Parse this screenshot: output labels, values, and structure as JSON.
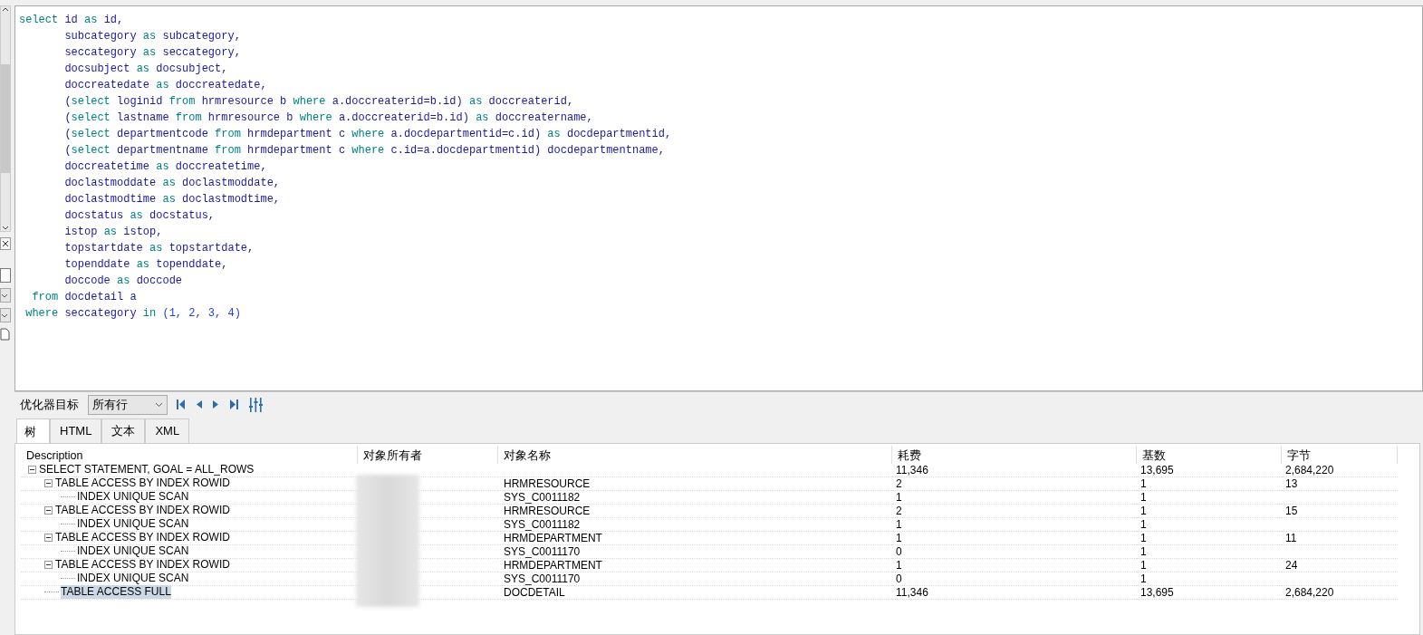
{
  "editor": {
    "lines": [
      [
        {
          "kind": "kw",
          "text": "select"
        },
        {
          "kind": "id",
          "text": " id "
        },
        {
          "kind": "kw",
          "text": "as"
        },
        {
          "kind": "id",
          "text": " id,"
        }
      ],
      [
        {
          "kind": "id",
          "text": "       subcategory "
        },
        {
          "kind": "kw",
          "text": "as"
        },
        {
          "kind": "id",
          "text": " subcategory,"
        }
      ],
      [
        {
          "kind": "id",
          "text": "       seccategory "
        },
        {
          "kind": "kw",
          "text": "as"
        },
        {
          "kind": "id",
          "text": " seccategory,"
        }
      ],
      [
        {
          "kind": "id",
          "text": "       docsubject "
        },
        {
          "kind": "kw",
          "text": "as"
        },
        {
          "kind": "id",
          "text": " docsubject,"
        }
      ],
      [
        {
          "kind": "id",
          "text": "       doccreatedate "
        },
        {
          "kind": "kw",
          "text": "as"
        },
        {
          "kind": "id",
          "text": " doccreatedate,"
        }
      ],
      [
        {
          "kind": "id",
          "text": "       ("
        },
        {
          "kind": "kw",
          "text": "select"
        },
        {
          "kind": "id",
          "text": " loginid "
        },
        {
          "kind": "kw",
          "text": "from"
        },
        {
          "kind": "id",
          "text": " hrmresource b "
        },
        {
          "kind": "kw",
          "text": "where"
        },
        {
          "kind": "id",
          "text": " a.doccreaterid=b.id) "
        },
        {
          "kind": "kw",
          "text": "as"
        },
        {
          "kind": "id",
          "text": " doccreaterid,"
        }
      ],
      [
        {
          "kind": "id",
          "text": "       ("
        },
        {
          "kind": "kw",
          "text": "select"
        },
        {
          "kind": "id",
          "text": " lastname "
        },
        {
          "kind": "kw",
          "text": "from"
        },
        {
          "kind": "id",
          "text": " hrmresource b "
        },
        {
          "kind": "kw",
          "text": "where"
        },
        {
          "kind": "id",
          "text": " a.doccreaterid=b.id) "
        },
        {
          "kind": "kw",
          "text": "as"
        },
        {
          "kind": "id",
          "text": " doccreatername,"
        }
      ],
      [
        {
          "kind": "id",
          "text": "       ("
        },
        {
          "kind": "kw",
          "text": "select"
        },
        {
          "kind": "id",
          "text": " departmentcode "
        },
        {
          "kind": "kw",
          "text": "from"
        },
        {
          "kind": "id",
          "text": " hrmdepartment c "
        },
        {
          "kind": "kw",
          "text": "where"
        },
        {
          "kind": "id",
          "text": " a.docdepartmentid=c.id) "
        },
        {
          "kind": "kw",
          "text": "as"
        },
        {
          "kind": "id",
          "text": " docdepartmentid,"
        }
      ],
      [
        {
          "kind": "id",
          "text": "       ("
        },
        {
          "kind": "kw",
          "text": "select"
        },
        {
          "kind": "id",
          "text": " departmentname "
        },
        {
          "kind": "kw",
          "text": "from"
        },
        {
          "kind": "id",
          "text": " hrmdepartment c "
        },
        {
          "kind": "kw",
          "text": "where"
        },
        {
          "kind": "id",
          "text": " c.id=a.docdepartmentid) docdepartmentname,"
        }
      ],
      [
        {
          "kind": "id",
          "text": "       doccreatetime "
        },
        {
          "kind": "kw",
          "text": "as"
        },
        {
          "kind": "id",
          "text": " doccreatetime,"
        }
      ],
      [
        {
          "kind": "id",
          "text": "       doclastmoddate "
        },
        {
          "kind": "kw",
          "text": "as"
        },
        {
          "kind": "id",
          "text": " doclastmoddate,"
        }
      ],
      [
        {
          "kind": "id",
          "text": "       doclastmodtime "
        },
        {
          "kind": "kw",
          "text": "as"
        },
        {
          "kind": "id",
          "text": " doclastmodtime,"
        }
      ],
      [
        {
          "kind": "id",
          "text": "       docstatus "
        },
        {
          "kind": "kw",
          "text": "as"
        },
        {
          "kind": "id",
          "text": " docstatus,"
        }
      ],
      [
        {
          "kind": "id",
          "text": "       istop "
        },
        {
          "kind": "kw",
          "text": "as"
        },
        {
          "kind": "id",
          "text": " istop,"
        }
      ],
      [
        {
          "kind": "id",
          "text": "       topstartdate "
        },
        {
          "kind": "kw",
          "text": "as"
        },
        {
          "kind": "id",
          "text": " topstartdate,"
        }
      ],
      [
        {
          "kind": "id",
          "text": "       topenddate "
        },
        {
          "kind": "kw",
          "text": "as"
        },
        {
          "kind": "id",
          "text": " topenddate,"
        }
      ],
      [
        {
          "kind": "id",
          "text": "       doccode "
        },
        {
          "kind": "kw",
          "text": "as"
        },
        {
          "kind": "id",
          "text": " doccode"
        }
      ],
      [
        {
          "kind": "kw",
          "text": "  from"
        },
        {
          "kind": "id",
          "text": " docdetail a"
        }
      ],
      [
        {
          "kind": "kw",
          "text": " where"
        },
        {
          "kind": "id",
          "text": " seccategory "
        },
        {
          "kind": "kw",
          "text": "in"
        },
        {
          "kind": "num",
          "text": " (1, 2, 3, 4)"
        }
      ]
    ]
  },
  "toolbar": {
    "label": "优化器目标",
    "goal": "所有行"
  },
  "tabs": [
    {
      "label": "树",
      "selected": true
    },
    {
      "label": "HTML",
      "selected": false
    },
    {
      "label": "文本",
      "selected": false
    },
    {
      "label": "XML",
      "selected": false
    }
  ],
  "plan": {
    "columns": [
      "Description",
      "对象所有者",
      "对象名称",
      "耗费",
      "基数",
      "字节"
    ],
    "rows": [
      {
        "description": "SELECT STATEMENT, GOAL = ALL_ROWS",
        "cost": "11,346",
        "cardinality": "13,695",
        "bytes": "2,684,220",
        "selected": false,
        "expanded": true,
        "children": [
          {
            "description": "TABLE ACCESS BY INDEX ROWID",
            "object_name": "HRMRESOURCE",
            "cost": "2",
            "cardinality": "1",
            "bytes": "13",
            "selected": false,
            "expanded": true,
            "children": [
              {
                "description": "INDEX UNIQUE SCAN",
                "object_name": "SYS_C0011182",
                "cost": "1",
                "cardinality": "1",
                "selected": false
              }
            ]
          },
          {
            "description": "TABLE ACCESS BY INDEX ROWID",
            "object_name": "HRMRESOURCE",
            "cost": "2",
            "cardinality": "1",
            "bytes": "15",
            "selected": false,
            "expanded": true,
            "children": [
              {
                "description": "INDEX UNIQUE SCAN",
                "object_name": "SYS_C0011182",
                "cost": "1",
                "cardinality": "1",
                "selected": false
              }
            ]
          },
          {
            "description": "TABLE ACCESS BY INDEX ROWID",
            "object_name": "HRMDEPARTMENT",
            "cost": "1",
            "cardinality": "1",
            "bytes": "11",
            "selected": false,
            "expanded": true,
            "children": [
              {
                "description": "INDEX UNIQUE SCAN",
                "object_name": "SYS_C0011170",
                "cost": "0",
                "cardinality": "1",
                "selected": false
              }
            ]
          },
          {
            "description": "TABLE ACCESS BY INDEX ROWID",
            "object_name": "HRMDEPARTMENT",
            "cost": "1",
            "cardinality": "1",
            "bytes": "24",
            "selected": false,
            "expanded": true,
            "children": [
              {
                "description": "INDEX UNIQUE SCAN",
                "object_name": "SYS_C0011170",
                "cost": "0",
                "cardinality": "1",
                "selected": false
              }
            ]
          },
          {
            "description": "TABLE ACCESS FULL",
            "object_name": "DOCDETAIL",
            "cost": "11,346",
            "cardinality": "13,695",
            "bytes": "2,684,220",
            "selected": true
          }
        ]
      }
    ]
  }
}
